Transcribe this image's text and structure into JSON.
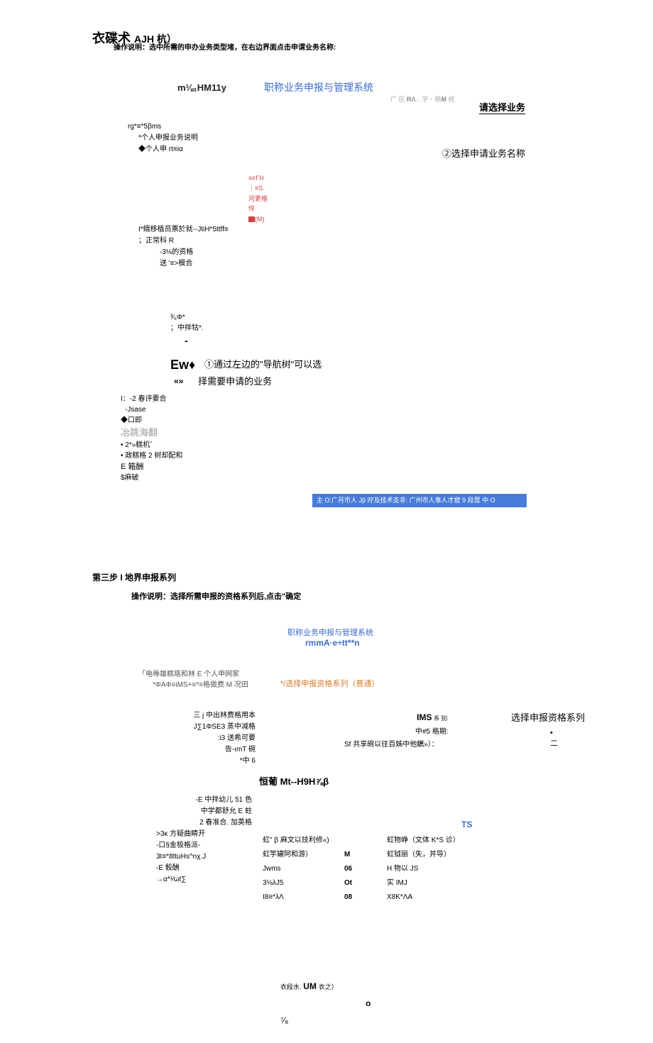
{
  "header": {
    "title_main": "衣碟术",
    "title_sub": "AJH 杭）",
    "op_desc": "操作说明：选中所需的申办业务类型堵，在右边界面点击申谓业务名称:"
  },
  "system": {
    "left_label": "m⅛₁HM11y",
    "right_label": "职称业务申报与管理系统",
    "sub_left": "广 区 ",
    "sub_bold1": "RΛ",
    "sub_mid": "…字‧皓",
    "sub_bold2": "M",
    "sub_end": " 统"
  },
  "left_tree": {
    "root": "rg*≡*5βms",
    "items": [
      "*个人申报业务说明",
      "◆个人申 rt≡iα",
      "I*蛾移植员票於就--JtiH*5ttff≡",
      "；正常科 R",
      "-3⅛的资格",
      "送 '≡>模合"
    ]
  },
  "red_note": "≡≠ΓH｜≡S.河更格悴▇(M)",
  "right_prompt": "请选择业务",
  "step2_label": "②选择申请业务名称",
  "mid_block": {
    "line1": "³⁄₆Φ*",
    "line2": "；中拌牯*.",
    "dash": "-",
    "ew": "Ew♦",
    "dbl_arrow": "«»",
    "step1_l1": "①通过左边的\"导航树\"可以选",
    "step1_l2": "择需要申请的业务"
  },
  "lower_list": {
    "items": [
      "I：-2 春评要合",
      "-Jsase",
      "◆口即"
    ],
    "gray": "冶跳海翻",
    "b1": "• 2*»糕机ˆ",
    "b2": "• 政糕格 2 树却配和",
    "e1": "E 箱酬",
    "e2": "$麻破"
  },
  "blue_bar": "主 O:广月市人 Jβ 咛及技术支非: 广州市人事人才窟 9 段貿 中 O",
  "step3": {
    "title": "第三步 I 地界申报系列",
    "op_desc": "操作说明：选择所需申报的资格系列后,点击\"确定",
    "sys_l1": "职称业务申报与管理系统",
    "sys_l2": "rmmA·e÷tt**n",
    "left_top_l1": "「电辱雄糕珞和林 E 个人申网家",
    "left_top_l2": "*ΦAΦ≡iMS+≡*≡格做费 M 况田",
    "orange": "*/选择申报资格系列（普通）",
    "left_list": [
      "三 j 中出林费格用本",
      "J∑1ΦSE3 蒸中减格",
      ":i3 送希可要",
      "告-ımT 碗",
      "*中 6"
    ],
    "mid_labels": {
      "ims": "IMS",
      "ims_sub": "系 别:",
      "mid_row": "中#5 格期:",
      "sf_row": "Sf 共享碗以往百姊中他觽»）："
    },
    "right_label": "选择申报资格系列",
    "dots": [
      "•",
      "二"
    ],
    "center_title": "恒葡 Mt--H9H⅞β",
    "lower_left": [
      "-E 中拌幼儿 51 色",
      "中学都舒允 E 蛀",
      "2 春准合. 加英格",
      ">3κ 方疑曲睛开",
      "-口§金极格派-",
      "3t≡*8ttuHs^nχ.J",
      "-E 骰酬",
      "→α*¹⁄ωt∑"
    ],
    "table1": [
      {
        "c1": "虹\" β 麻文以技利修«)",
        "c2": ""
      },
      {
        "c1": "虹竽罐阿和游）",
        "c2": "M"
      },
      {
        "c1": "Jwms",
        "c2": "06"
      },
      {
        "c1": "3⅛λJ5",
        "c2": "Ot"
      },
      {
        "c1": "I8≡*λΛ",
        "c2": "08"
      }
    ],
    "table2": [
      "虹物峥（文体 K*S 诊）",
      "虹钺丽（失，并导）",
      "H 物以 JS",
      "实 IMJ",
      "X8K*ΛA"
    ],
    "ts": "TS",
    "bottom": {
      "l1_a": "衣段水.",
      "l1_b": "UM",
      "l1_c": " 衣之）",
      "o": "o",
      "frac": "⁷⁄₈"
    }
  }
}
